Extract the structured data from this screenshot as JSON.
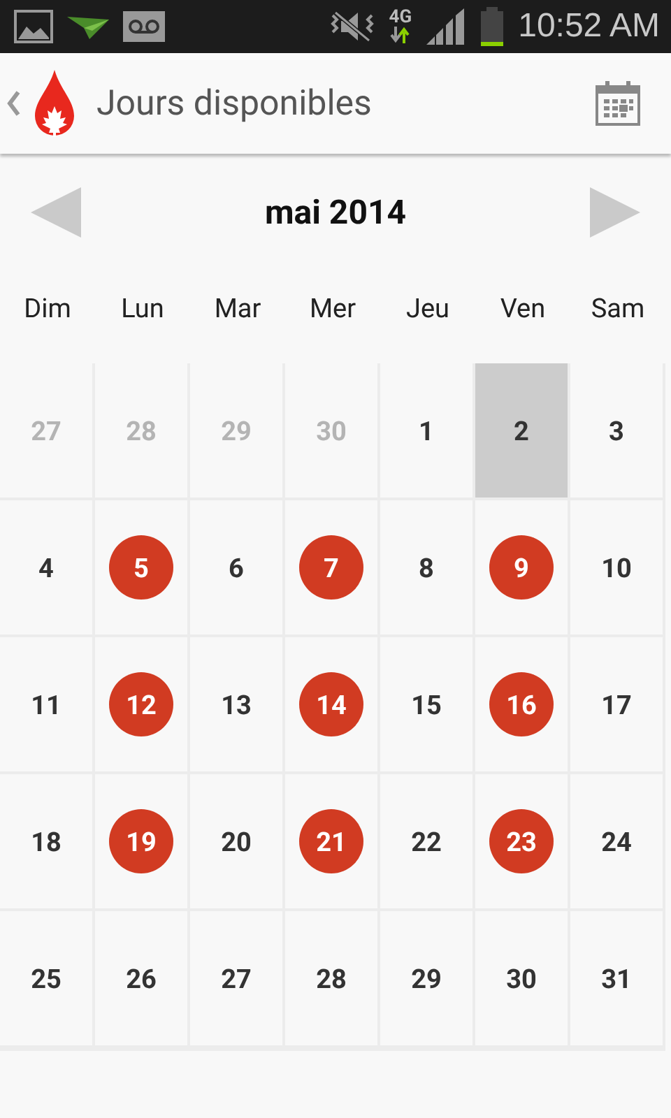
{
  "status_bar": {
    "network": "4G",
    "time": "10:52 AM"
  },
  "app_bar": {
    "title": "Jours disponibles"
  },
  "calendar": {
    "month": "mai 2014",
    "weekdays": [
      "Dim",
      "Lun",
      "Mar",
      "Mer",
      "Jeu",
      "Ven",
      "Sam"
    ],
    "days": [
      {
        "label": "27",
        "kind": "outside",
        "selected": false
      },
      {
        "label": "28",
        "kind": "outside",
        "selected": false
      },
      {
        "label": "29",
        "kind": "outside",
        "selected": false
      },
      {
        "label": "30",
        "kind": "outside",
        "selected": false
      },
      {
        "label": "1",
        "kind": "plain",
        "selected": false
      },
      {
        "label": "2",
        "kind": "plain",
        "selected": true
      },
      {
        "label": "3",
        "kind": "plain",
        "selected": false
      },
      {
        "label": "4",
        "kind": "plain",
        "selected": false
      },
      {
        "label": "5",
        "kind": "available",
        "selected": false
      },
      {
        "label": "6",
        "kind": "plain",
        "selected": false
      },
      {
        "label": "7",
        "kind": "available",
        "selected": false
      },
      {
        "label": "8",
        "kind": "plain",
        "selected": false
      },
      {
        "label": "9",
        "kind": "available",
        "selected": false
      },
      {
        "label": "10",
        "kind": "plain",
        "selected": false
      },
      {
        "label": "11",
        "kind": "plain",
        "selected": false
      },
      {
        "label": "12",
        "kind": "available",
        "selected": false
      },
      {
        "label": "13",
        "kind": "plain",
        "selected": false
      },
      {
        "label": "14",
        "kind": "available",
        "selected": false
      },
      {
        "label": "15",
        "kind": "plain",
        "selected": false
      },
      {
        "label": "16",
        "kind": "available",
        "selected": false
      },
      {
        "label": "17",
        "kind": "plain",
        "selected": false
      },
      {
        "label": "18",
        "kind": "plain",
        "selected": false
      },
      {
        "label": "19",
        "kind": "available",
        "selected": false
      },
      {
        "label": "20",
        "kind": "plain",
        "selected": false
      },
      {
        "label": "21",
        "kind": "available",
        "selected": false
      },
      {
        "label": "22",
        "kind": "plain",
        "selected": false
      },
      {
        "label": "23",
        "kind": "available",
        "selected": false
      },
      {
        "label": "24",
        "kind": "plain",
        "selected": false
      },
      {
        "label": "25",
        "kind": "plain",
        "selected": false
      },
      {
        "label": "26",
        "kind": "plain",
        "selected": false
      },
      {
        "label": "27",
        "kind": "plain",
        "selected": false
      },
      {
        "label": "28",
        "kind": "plain",
        "selected": false
      },
      {
        "label": "29",
        "kind": "plain",
        "selected": false
      },
      {
        "label": "30",
        "kind": "plain",
        "selected": false
      },
      {
        "label": "31",
        "kind": "plain",
        "selected": false
      }
    ]
  }
}
